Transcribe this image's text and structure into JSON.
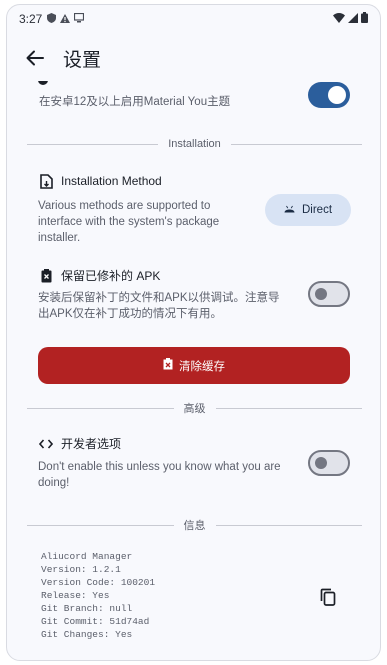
{
  "status_bar": {
    "time": "3:27",
    "left_icons": [
      "shield-icon",
      "warning-icon",
      "screen-icon"
    ],
    "right_icons": [
      "wifi-icon",
      "signal-icon",
      "battery-icon"
    ]
  },
  "app_bar": {
    "title": "设置",
    "back_icon": "back-arrow-icon"
  },
  "material_you": {
    "subtitle": "在安卓12及以上启用Material You主题",
    "toggle_on": true
  },
  "installation": {
    "section_label": "Installation",
    "method_title": "Installation Method",
    "method_description": "Various methods are supported to interface with the system's package installer.",
    "method_chip_label": "Direct",
    "keep_apk_title": "保留已修补的 APK",
    "keep_apk_description": "安装后保留补丁的文件和APK以供调试。注意导出APK仅在补丁成功的情况下有用。",
    "keep_apk_toggle_on": false,
    "clear_cache_label": "清除缓存"
  },
  "advanced": {
    "section_label": "高级",
    "dev_options_title": "开发者选项",
    "dev_options_description": "Don't enable this unless you know what you are doing!",
    "dev_toggle_on": false
  },
  "info": {
    "section_label": "信息",
    "lines": [
      "Aliucord Manager",
      "Version: 1.2.1",
      "Version Code: 100201",
      "Release: Yes",
      "Git Branch: null",
      "Git Commit: 51d74ad",
      "Git Changes: Yes"
    ],
    "copy_icon": "copy-icon"
  },
  "colors": {
    "accent": "#2b5e9c",
    "danger": "#b22222",
    "chip_bg": "#d8e3f4",
    "background": "#f8f9fd"
  }
}
